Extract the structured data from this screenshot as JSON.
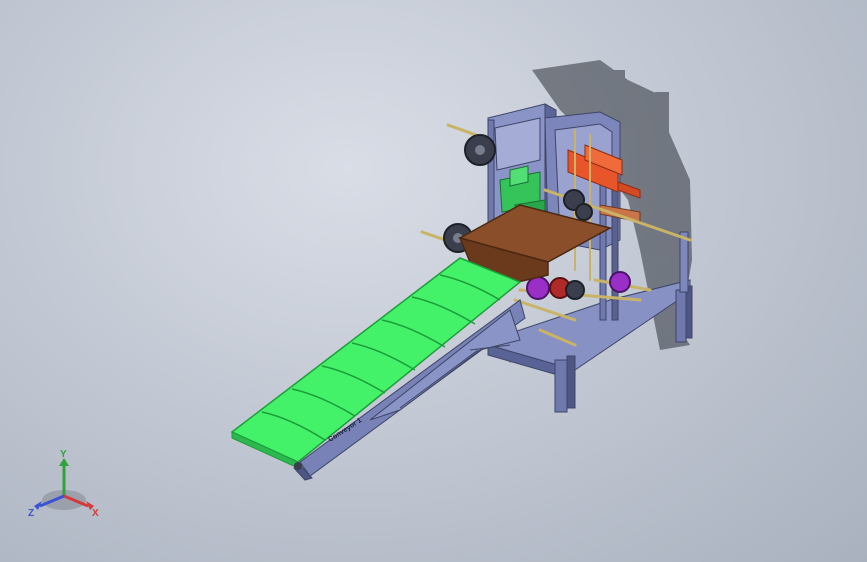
{
  "model": {
    "conveyor_label": "Conveyor 1"
  },
  "triad": {
    "x_label": "X",
    "y_label": "Y",
    "z_label": "Z"
  },
  "colors": {
    "frame": "#7a84b8",
    "frame_dark": "#4c557f",
    "belt": "#44f26a",
    "belt_dark": "#1c9e3a",
    "top_belt": "#8a4e2a",
    "hopper_orange": "#e8552b",
    "green_block": "#35c45a",
    "gear_purple": "#9a2fc7",
    "shaft": "#d6c27a",
    "shadow": "#3a3f48"
  }
}
